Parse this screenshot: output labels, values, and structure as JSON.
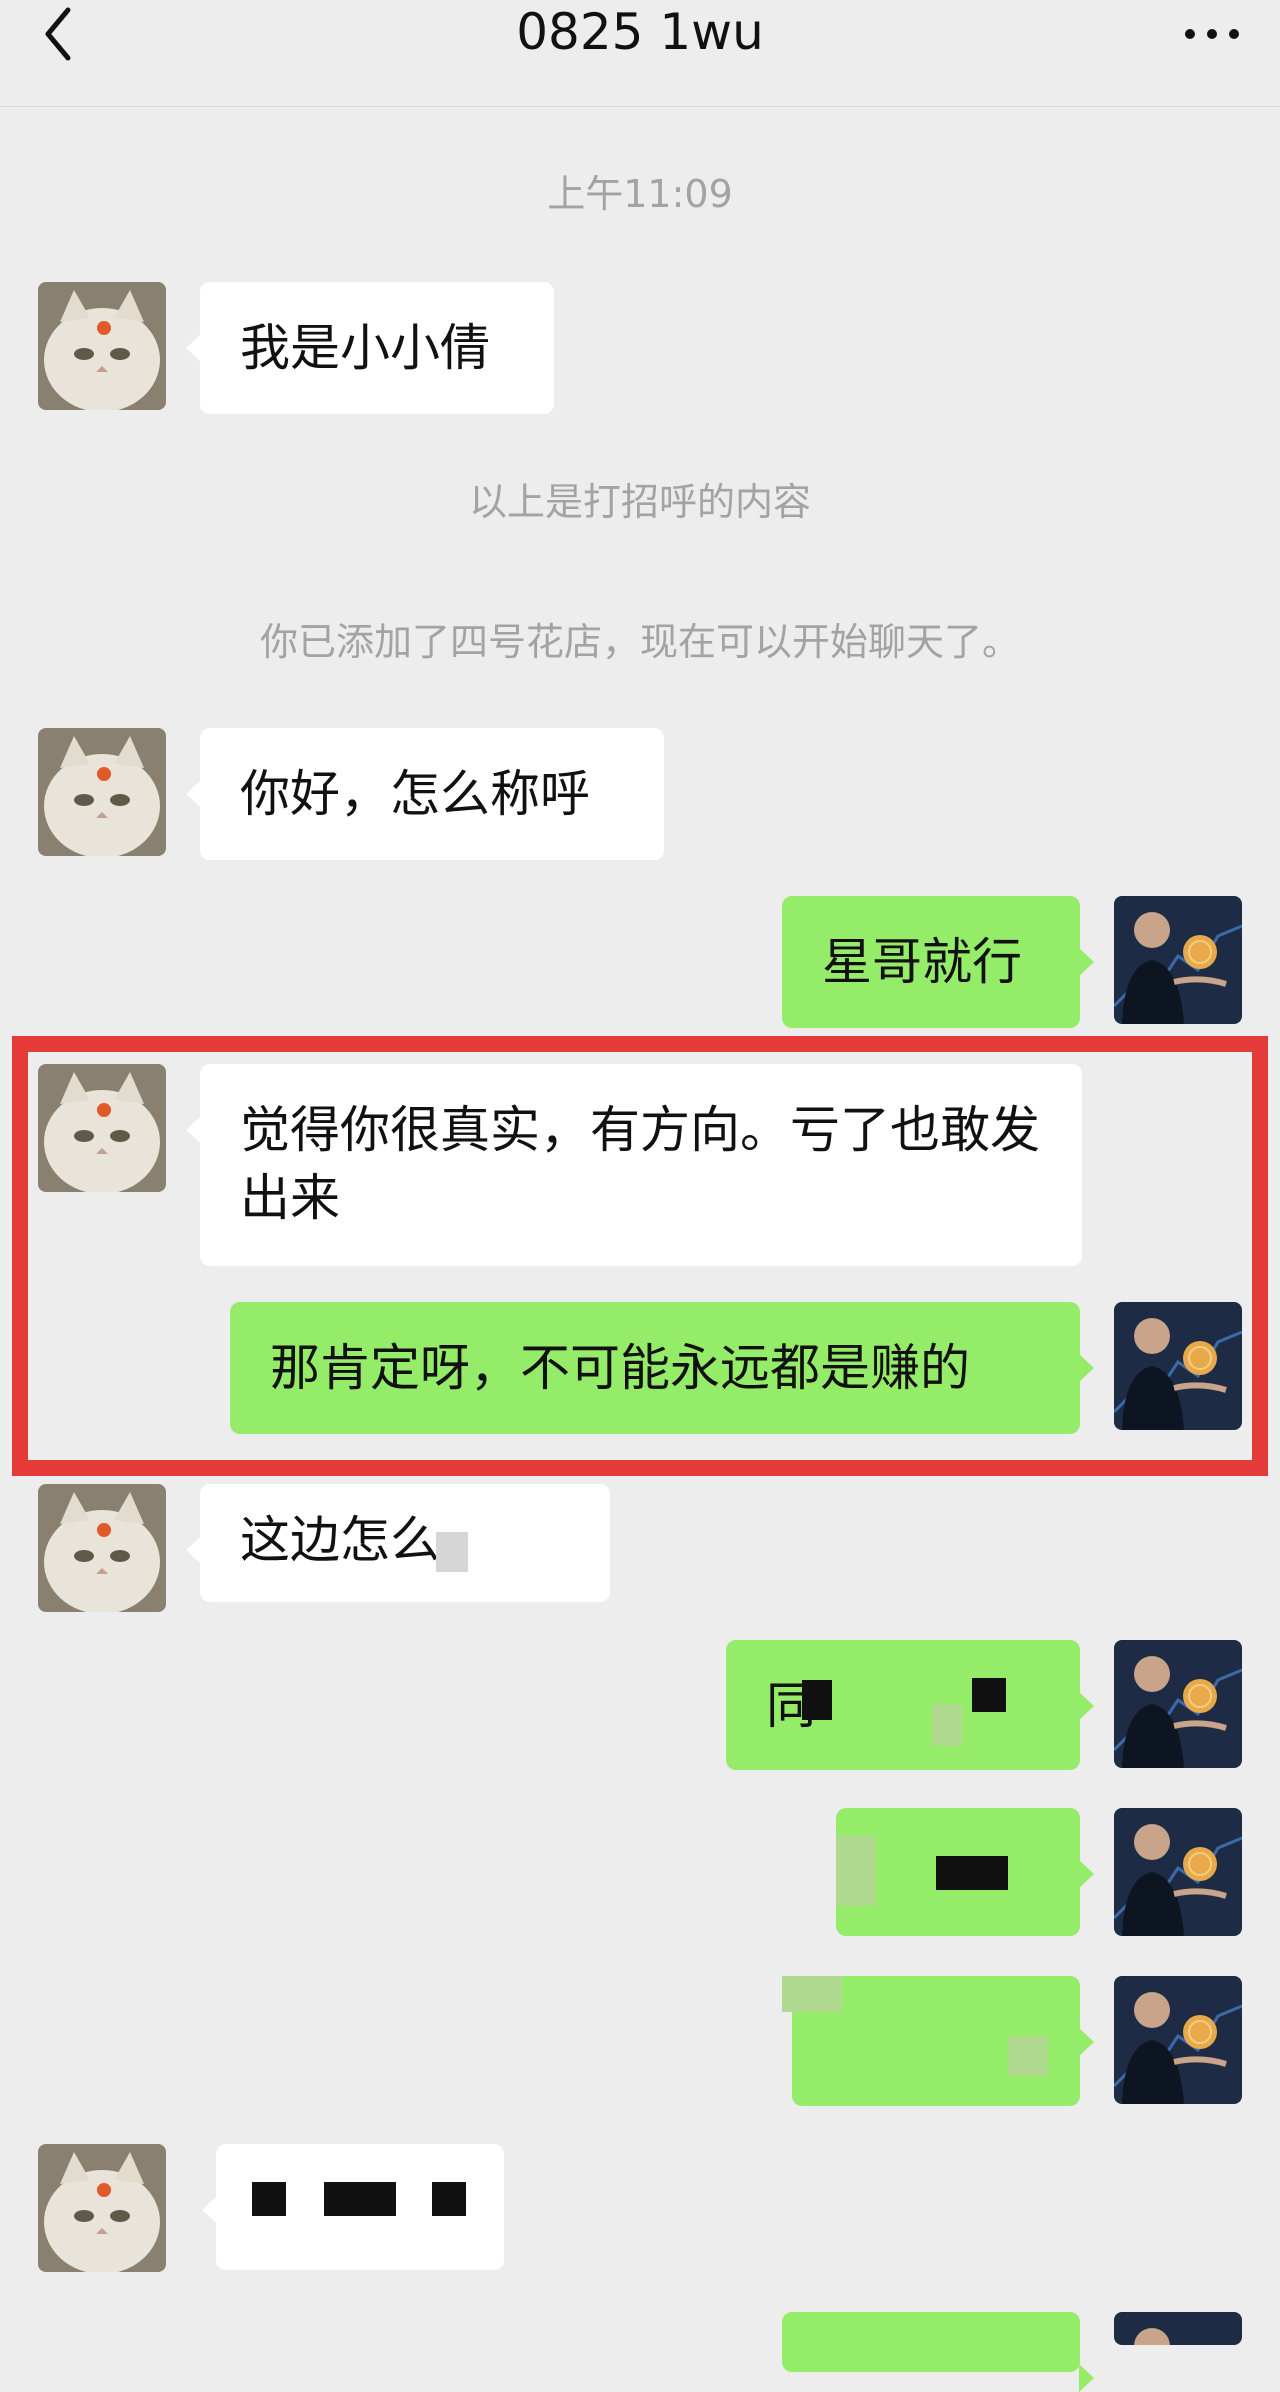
{
  "header": {
    "title": "0825 1wu",
    "back_icon": "chevron-left-icon",
    "more_icon": "more-dots-icon"
  },
  "timestamp": "上午11:09",
  "system_messages": {
    "greeting_note": "以上是打招呼的内容",
    "added_note": "你已添加了四号花店，现在可以开始聊天了。"
  },
  "messages": [
    {
      "side": "left",
      "text": "我是小小倩"
    },
    {
      "side": "left",
      "text": "你好，怎么称呼"
    },
    {
      "side": "right",
      "text": "星哥就行"
    },
    {
      "side": "left",
      "text": "觉得你很真实，有方向。亏了也敢发出来"
    },
    {
      "side": "right",
      "text": "那肯定呀，不可能永远都是赚的"
    },
    {
      "side": "left",
      "text": "这边怎么"
    },
    {
      "side": "right",
      "text": "同"
    },
    {
      "side": "right",
      "text": ""
    },
    {
      "side": "right",
      "text": ""
    },
    {
      "side": "left",
      "text": ""
    }
  ],
  "colors": {
    "background": "#ededed",
    "bubble_self": "#95ec69",
    "bubble_other": "#ffffff",
    "highlight": "#e53a3a"
  }
}
